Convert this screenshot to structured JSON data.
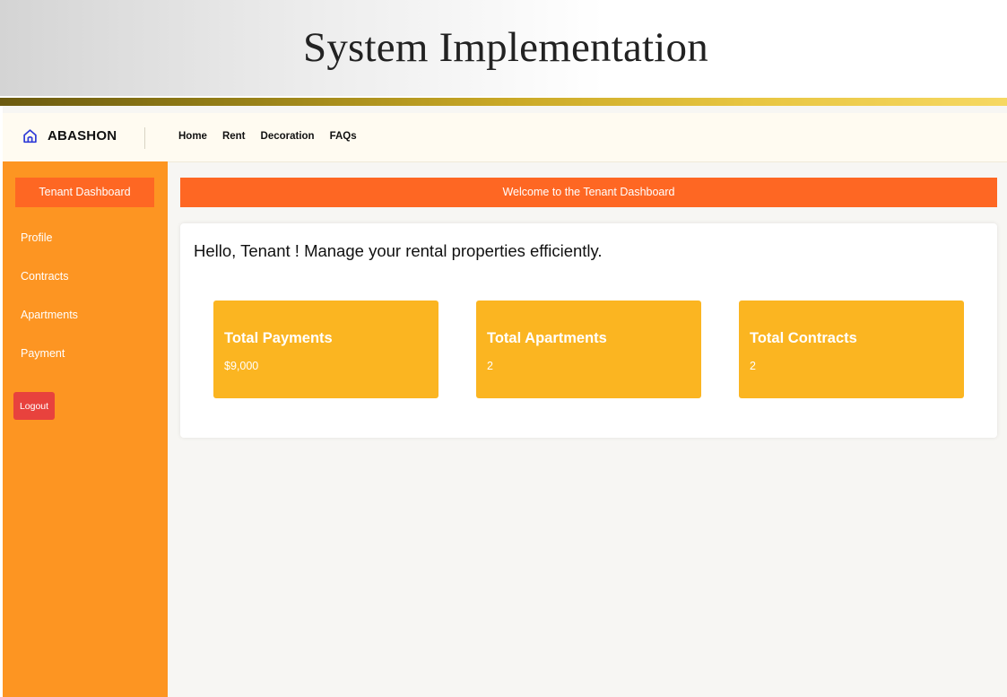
{
  "slide": {
    "title": "System Implementation"
  },
  "navbar": {
    "brand": "ABASHON",
    "links": [
      "Home",
      "Rent",
      "Decoration",
      "FAQs"
    ]
  },
  "sidebar": {
    "title": "Tenant Dashboard",
    "items": [
      "Profile",
      "Contracts",
      "Apartments",
      "Payment"
    ],
    "logout": "Logout"
  },
  "main": {
    "welcome": "Welcome to the Tenant Dashboard",
    "greeting": "Hello, Tenant ! Manage your rental properties efficiently.",
    "stats": [
      {
        "title": "Total Payments",
        "value": "$9,000"
      },
      {
        "title": "Total Apartments",
        "value": "2"
      },
      {
        "title": "Total Contracts",
        "value": "2"
      }
    ]
  },
  "colors": {
    "sidebar_bg": "#fd9522",
    "header_orange": "#fe6723",
    "stat_card": "#fbb521",
    "logout": "#e8423d",
    "brand_icon": "#2f3bd8"
  },
  "icons": {
    "brand": "house-outline-icon"
  }
}
